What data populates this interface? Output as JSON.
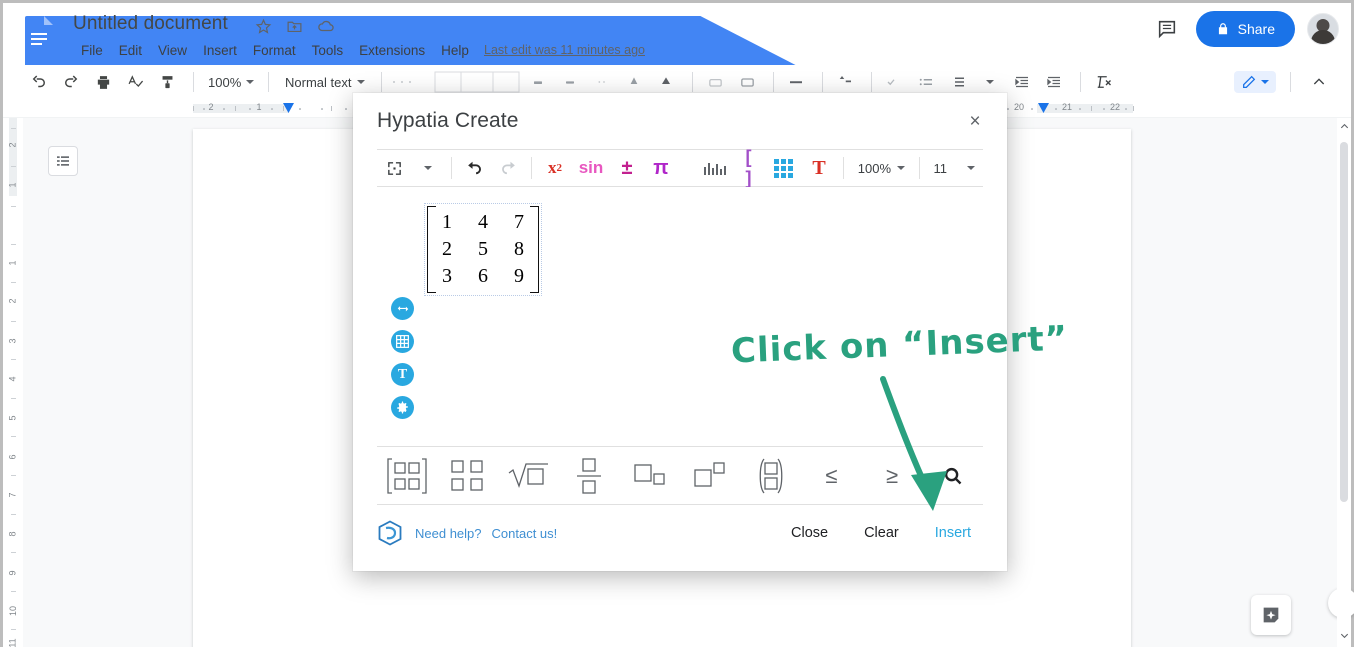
{
  "app": {
    "doc_title": "Untitled document",
    "title_icons": [
      "star-icon",
      "move-to-folder-icon",
      "cloud-saved-icon"
    ],
    "menus": [
      "File",
      "Edit",
      "View",
      "Insert",
      "Format",
      "Tools",
      "Extensions",
      "Help"
    ],
    "last_edit": "Last edit was 11 minutes ago",
    "share_label": "Share",
    "share_color": "#1a73e8",
    "comment_icon": "comment-icon",
    "avatar": "user-avatar"
  },
  "toolbar": {
    "undo": "undo-icon",
    "redo": "redo-icon",
    "print": "print-icon",
    "spellcheck": "spellcheck-icon",
    "paint_format": "paint-format-icon",
    "zoom_value": "100%",
    "style_value": "Normal text",
    "editing_mode": "editing-pen",
    "collapse": "collapse-toolbar-icon"
  },
  "ruler": {
    "h_labels": [
      "2",
      "1",
      "1",
      "20",
      "21",
      "22"
    ],
    "v_labels": [
      "2",
      "1",
      "1",
      "2",
      "3",
      "4",
      "5",
      "6",
      "7",
      "8",
      "9",
      "10",
      "11"
    ]
  },
  "canvas": {
    "outline_button": "document-outline-icon",
    "explore_button": "explore-icon",
    "side_panel_toggle": "expand-side-panel-icon"
  },
  "dialog": {
    "title": "Hypatia Create",
    "close_label": "×",
    "eq_toolbar": {
      "items": [
        {
          "name": "resize-handles-icon",
          "glyph": "⤣",
          "color": "#3c4043"
        },
        {
          "name": "undo-icon",
          "glyph": "↶",
          "color": "#3c4043"
        },
        {
          "name": "redo-icon",
          "glyph": "↷",
          "color": "#bdc1c6"
        },
        {
          "name": "superscript-icon",
          "glyph": "x²",
          "color": "#d93025"
        },
        {
          "name": "trigonometry-icon",
          "glyph": "sin",
          "color": "#e857c0"
        },
        {
          "name": "plus-minus-icon",
          "glyph": "±",
          "color": "#c2208f"
        },
        {
          "name": "greek-pi-icon",
          "glyph": "π",
          "color": "#b026c9"
        },
        {
          "name": "statistics-icon",
          "glyph": "bars",
          "color": "#5f6368"
        },
        {
          "name": "brackets-icon",
          "glyph": "[ ]",
          "color": "#a24fc9"
        },
        {
          "name": "matrix-grid-icon",
          "glyph": "grid",
          "color": "#29a8e0"
        },
        {
          "name": "text-color-icon",
          "glyph": "T",
          "color": "#d93025"
        }
      ],
      "zoom_value": "100%",
      "font_size_value": "11"
    },
    "matrix": {
      "rows": [
        [
          "1",
          "4",
          "7"
        ],
        [
          "2",
          "5",
          "8"
        ],
        [
          "3",
          "6",
          "9"
        ]
      ]
    },
    "side_tools": [
      {
        "name": "swap-arrows-icon",
        "glyph": "⇄"
      },
      {
        "name": "grid-icon",
        "glyph": "grid"
      },
      {
        "name": "text-tool-icon",
        "glyph": "T"
      },
      {
        "name": "settings-gear-icon",
        "glyph": "gear"
      }
    ],
    "symbols": [
      {
        "name": "matrix-bracket-symbol",
        "label": "matrix-with-brackets"
      },
      {
        "name": "matrix-plain-symbol",
        "label": "matrix-plain"
      },
      {
        "name": "square-root-symbol",
        "label": "square-root"
      },
      {
        "name": "fraction-symbol",
        "label": "fraction"
      },
      {
        "name": "subscript-symbol",
        "label": "subscript"
      },
      {
        "name": "superscript-symbol",
        "label": "superscript"
      },
      {
        "name": "binomial-symbol",
        "label": "binomial"
      },
      {
        "name": "less-than-equal-symbol",
        "label": "≤"
      },
      {
        "name": "greater-than-equal-symbol",
        "label": "≥"
      },
      {
        "name": "search-symbol",
        "label": "search"
      }
    ],
    "footer": {
      "logo": "hypatia-logo",
      "need_help": "Need help?",
      "contact_us": "Contact us!",
      "close": "Close",
      "clear": "Clear",
      "insert": "Insert",
      "insert_color": "#29a8e0"
    }
  },
  "annotation": {
    "text": "Click on “Insert”",
    "color": "#2aa17f",
    "arrow": "arrow-pointing-to-insert"
  }
}
